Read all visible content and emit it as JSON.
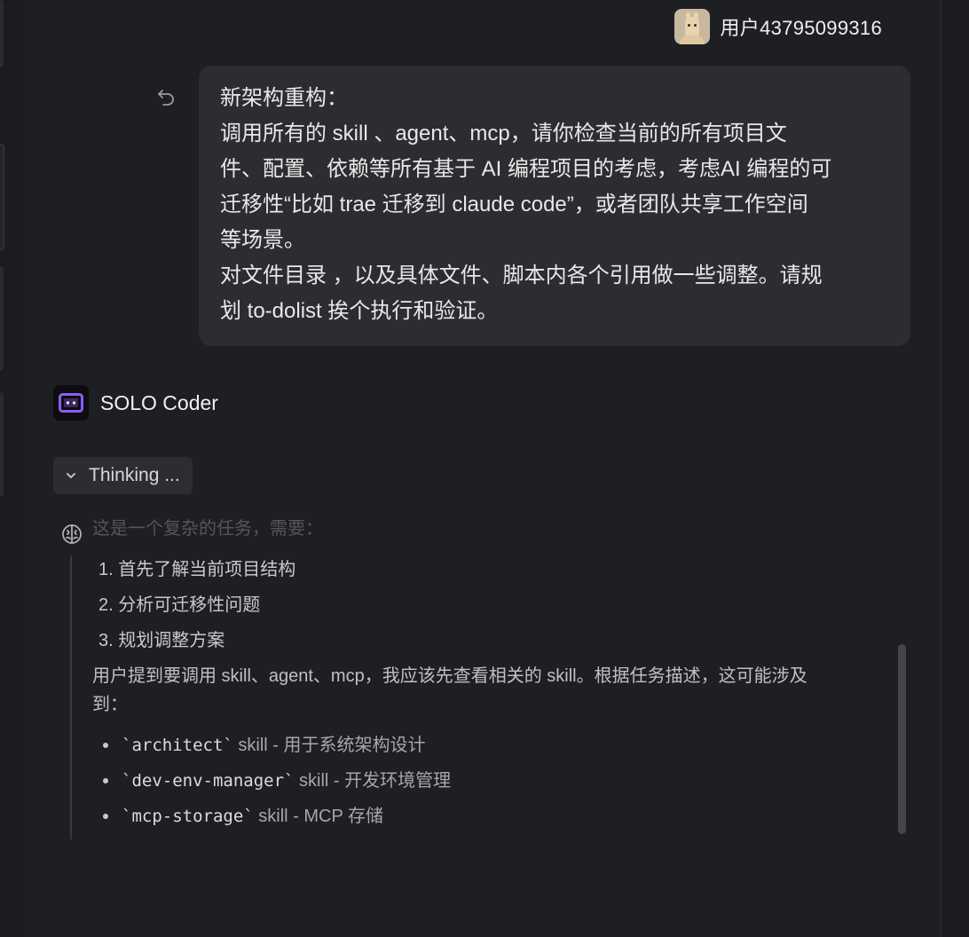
{
  "user": {
    "name": "用户43795099316",
    "avatar_icon": "llama-avatar"
  },
  "user_message": {
    "lines": [
      "新架构重构：",
      "调用所有的 skill 、agent、mcp，请你检查当前的所有项目文",
      "件、配置、依赖等所有基于 AI 编程项目的考虑，考虑AI 编程的可",
      "迁移性“比如 trae 迁移到 claude code”，或者团队共享工作空间",
      "等场景。",
      "对文件目录 ，以及具体文件、脚本内各个引用做一些调整。请规",
      "划 to-dolist 挨个执行和验证。"
    ],
    "undo_icon": "undo-icon"
  },
  "agent": {
    "name": "SOLO Coder",
    "logo_icon": "solo-coder-logo"
  },
  "thinking": {
    "toggle_label": "Thinking ...",
    "faded_line": "这是一个复杂的任务，需要：",
    "steps": [
      "1. 首先了解当前项目结构",
      "2. 分析可迁移性问题",
      "3. 规划调整方案"
    ],
    "para_line1": "用户提到要调用 skill、agent、mcp，我应该先查看相关的 skill。根据任务描述，这可能涉及",
    "para_line2": "到：",
    "skills": [
      {
        "code": "`architect`",
        "desc": " skill - 用于系统架构设计"
      },
      {
        "code": "`dev-env-manager`",
        "desc": " skill - 开发环境管理"
      },
      {
        "code": "`mcp-storage`",
        "desc": " skill - MCP 存储"
      }
    ]
  },
  "colors": {
    "background": "#1e1f22",
    "bubble": "#2c2d31",
    "accent": "#8b5cf6"
  }
}
